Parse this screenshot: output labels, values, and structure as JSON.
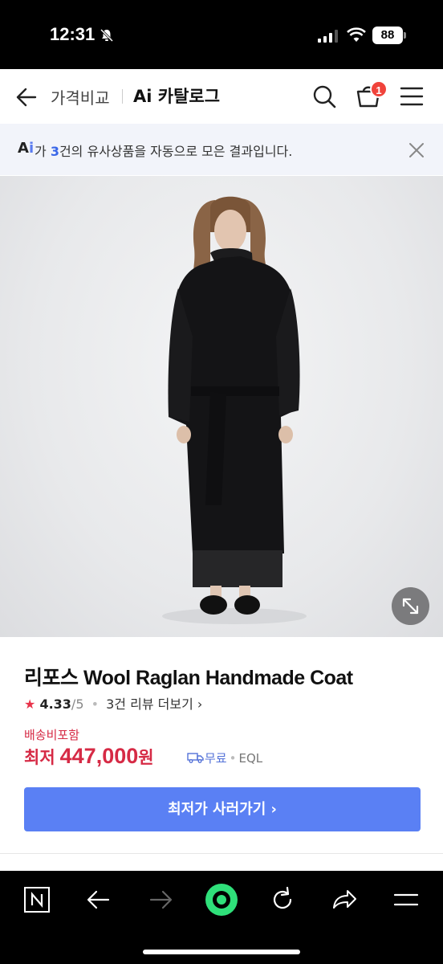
{
  "status_bar": {
    "time": "12:31",
    "battery": "88"
  },
  "header": {
    "breadcrumb": "가격비교",
    "title": "Ai 카탈로그",
    "cart_count": "1"
  },
  "banner": {
    "ai_label_a": "A",
    "ai_label_i": "i",
    "text_prefix": "가 ",
    "count": "3",
    "text_suffix": "건의 유사상품을 자동으로 모은 결과입니다."
  },
  "product": {
    "name": "리포스 Wool Raglan Handmade Coat",
    "rating_score": "4.33",
    "rating_max": "/5",
    "review_link": "3건 리뷰 더보기",
    "shipping_label": "배송비포함",
    "lowest_label": "최저",
    "price": "447,000",
    "currency": "원",
    "delivery": "무료",
    "store": "EQL",
    "buy_button": "최저가 사러가기"
  },
  "colors": {
    "accent": "#5a80f4",
    "price": "#d62a45",
    "badge": "#f0433b",
    "browser_center": "#2fe07a"
  },
  "icons": {
    "back": "arrow-left-icon",
    "search": "search-icon",
    "cart": "cart-icon",
    "menu": "hamburger-menu-icon",
    "close": "close-icon",
    "expand": "expand-icon",
    "star": "star-icon",
    "truck": "truck-icon"
  }
}
